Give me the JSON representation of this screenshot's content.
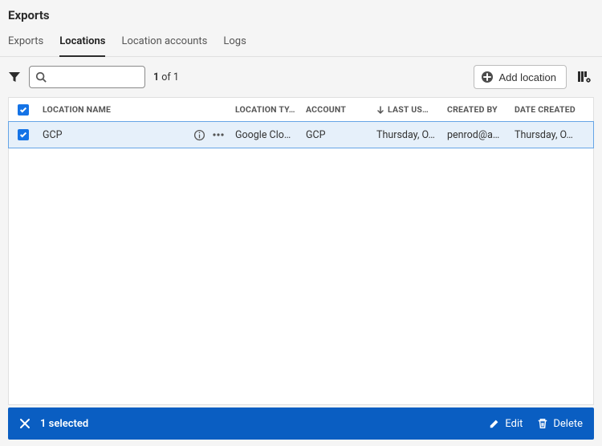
{
  "header": {
    "title": "Exports"
  },
  "tabs": [
    {
      "label": "Exports",
      "active": false
    },
    {
      "label": "Locations",
      "active": true
    },
    {
      "label": "Location accounts",
      "active": false
    },
    {
      "label": "Logs",
      "active": false
    }
  ],
  "toolbar": {
    "search_value": "",
    "counter_current": "1",
    "counter_sep": "of",
    "counter_total": "1",
    "add_location_label": "Add location"
  },
  "table": {
    "columns": {
      "name": "LOCATION NAME",
      "type": "LOCATION TY…",
      "account": "ACCOUNT",
      "last_used": "LAST US…",
      "created_by": "CREATED BY",
      "date_created": "DATE CREATED"
    },
    "rows": [
      {
        "checked": true,
        "name": "GCP",
        "type": "Google Clo…",
        "account": "GCP",
        "last_used": "Thursday, O…",
        "created_by": "penrod@ad…",
        "date_created": "Thursday, O…"
      }
    ]
  },
  "selection": {
    "label": "1 selected",
    "edit_label": "Edit",
    "delete_label": "Delete"
  }
}
